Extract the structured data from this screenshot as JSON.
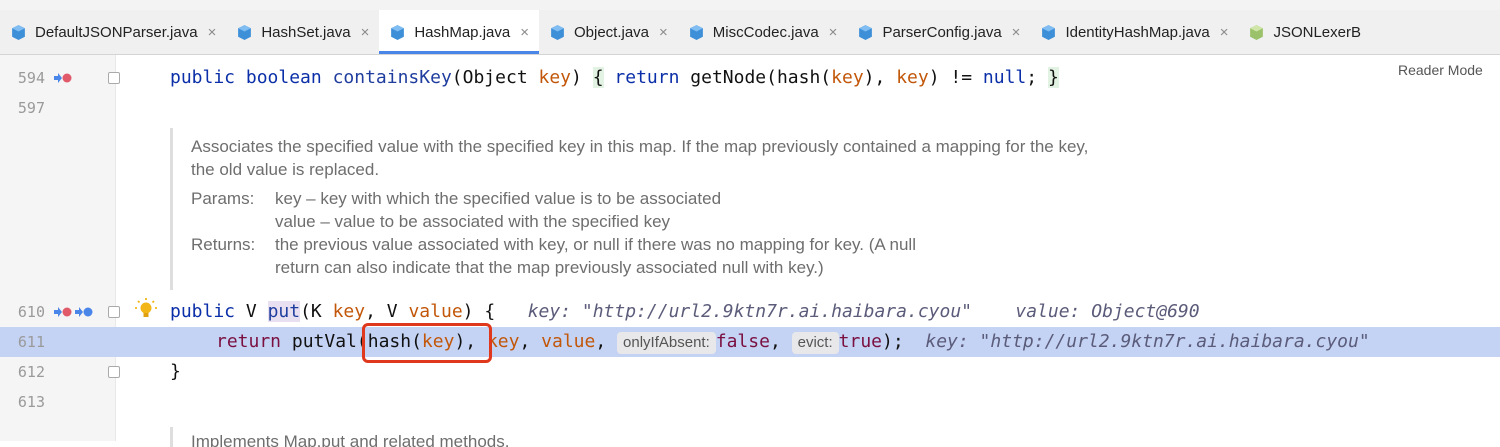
{
  "tabs": [
    {
      "label": "DefaultJSONParser.java",
      "icon": "java-class-icon",
      "active": false,
      "closable": true
    },
    {
      "label": "HashSet.java",
      "icon": "java-class-icon",
      "active": false,
      "closable": true
    },
    {
      "label": "HashMap.java",
      "icon": "java-class-icon",
      "active": true,
      "closable": true
    },
    {
      "label": "Object.java",
      "icon": "java-class-icon",
      "active": false,
      "closable": true
    },
    {
      "label": "MiscCodec.java",
      "icon": "java-class-icon",
      "active": false,
      "closable": true
    },
    {
      "label": "ParserConfig.java",
      "icon": "java-class-icon",
      "active": false,
      "closable": true
    },
    {
      "label": "IdentityHashMap.java",
      "icon": "java-class-icon",
      "active": false,
      "closable": true
    },
    {
      "label": "JSONLexerB",
      "icon": "java-interface-icon",
      "active": false,
      "closable": false
    }
  ],
  "close_glyph": "×",
  "reader_mode": "Reader Mode",
  "lines": {
    "l594": {
      "num": "594"
    },
    "l597": {
      "num": "597"
    },
    "l610": {
      "num": "610"
    },
    "l611": {
      "num": "611"
    },
    "l612": {
      "num": "612"
    },
    "l613": {
      "num": "613"
    }
  },
  "code": {
    "l594": {
      "public": "public",
      "boolean": "boolean",
      "method": "containsKey",
      "open": "(Object ",
      "param": "key",
      "close": ") ",
      "brace_open": "{",
      "return": "return",
      "call": "getNode(hash(",
      "arg1": "key",
      "mid": "), ",
      "arg2": "key",
      "neq": ") != ",
      "null": "null",
      "semi": ";",
      "brace_close": "}"
    },
    "l610": {
      "public": "public",
      "type": "V ",
      "method": "put",
      "open": "(K ",
      "param1": "key",
      "sep": ", V ",
      "param2": "value",
      "close": ") {",
      "hint1": "key: \"http://url2.9ktn7r.ai.haibara.cyou\"",
      "hint2": "value: Object@690"
    },
    "l611": {
      "return": "return",
      "call": "putVal(hash(",
      "arg": "key",
      "close": "), ",
      "arg2": "key",
      "comma": ", ",
      "arg3": "value",
      "comma2": ", ",
      "pill1": "onlyIfAbsent:",
      "false": "false",
      "comma3": ", ",
      "pill2": "evict:",
      "true": "true",
      "end": ");",
      "hint": "key: \"http://url2.9ktn7r.ai.haibara.cyou\""
    },
    "l612": {
      "brace": "}"
    }
  },
  "javadoc": {
    "description": "Associates the specified value with the specified key in this map. If the map previously contained a mapping for the key, the old value is replaced.",
    "params_label": "Params:",
    "param1": "key – key with which the specified value is to be associated",
    "param2": "value – value to be associated with the specified key",
    "returns_label": "Returns:",
    "returns1": "the previous value associated with key, or null if there was no mapping for key. (A null",
    "returns2": "return can also indicate that the map previously associated null with key.)"
  },
  "javadoc2": {
    "text": "Implements Map.put and related methods."
  },
  "colors": {
    "highlight_line": "#c4d2f3",
    "annotation_box": "#e0381c",
    "active_tab_underline": "#4a86e8"
  }
}
